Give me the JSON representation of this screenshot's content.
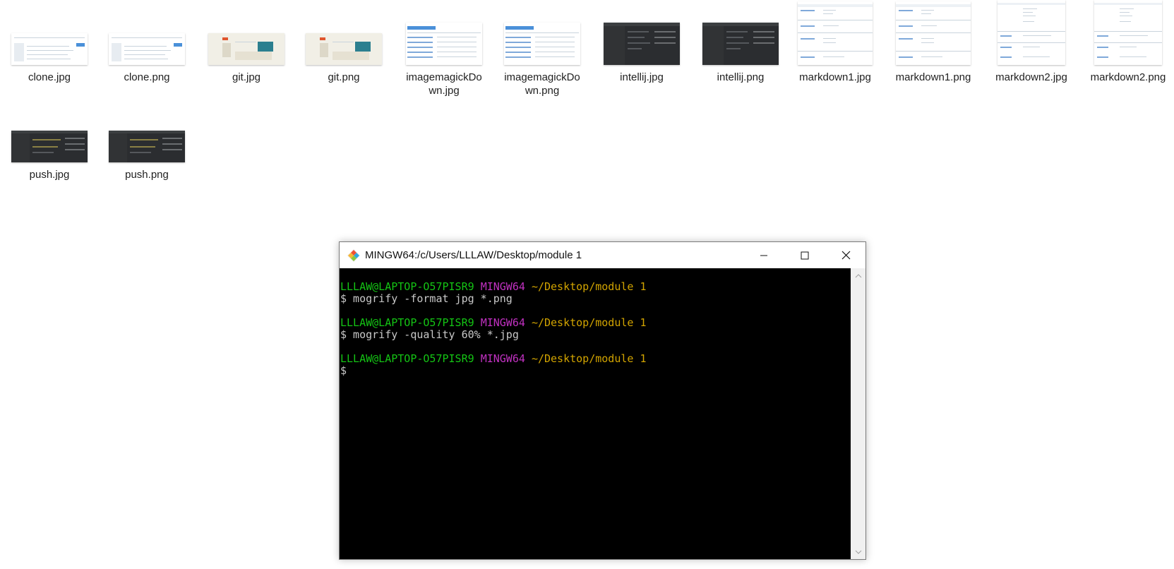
{
  "files": [
    {
      "name": "clone.jpg",
      "thumb": "clone"
    },
    {
      "name": "clone.png",
      "thumb": "clone"
    },
    {
      "name": "git.jpg",
      "thumb": "git"
    },
    {
      "name": "git.png",
      "thumb": "git"
    },
    {
      "name": "imagemagickDown.jpg",
      "thumb": "table"
    },
    {
      "name": "imagemagickDown.png",
      "thumb": "table"
    },
    {
      "name": "intellij.jpg",
      "thumb": "dark"
    },
    {
      "name": "intellij.png",
      "thumb": "dark"
    },
    {
      "name": "markdown1.jpg",
      "thumb": "doc"
    },
    {
      "name": "markdown1.png",
      "thumb": "doc"
    },
    {
      "name": "markdown2.jpg",
      "thumb": "doctall"
    },
    {
      "name": "markdown2.png",
      "thumb": "doctall"
    },
    {
      "name": "push.jpg",
      "thumb": "dark2"
    },
    {
      "name": "push.png",
      "thumb": "dark2"
    }
  ],
  "terminal": {
    "title": "MINGW64:/c/Users/LLLAW/Desktop/module 1",
    "prompt_user": "LLLAW@LAPTOP-O57PISR9",
    "prompt_env": "MINGW64",
    "prompt_path": "~/Desktop/module 1",
    "command1": "$ mogrify -format jpg *.png",
    "command2": "$ mogrify -quality 60% *.jpg",
    "prompt_symbol": "$"
  },
  "icons": {
    "logo": "git-logo-icon",
    "minimize": "minimize-icon",
    "maximize": "maximize-icon",
    "close": "close-icon",
    "scroll_up": "chevron-up-icon",
    "scroll_down": "chevron-down-icon"
  },
  "colors": {
    "prompt_user": "#14c414",
    "prompt_env": "#c131c1",
    "prompt_path": "#d2a400",
    "terminal_bg": "#000000"
  }
}
